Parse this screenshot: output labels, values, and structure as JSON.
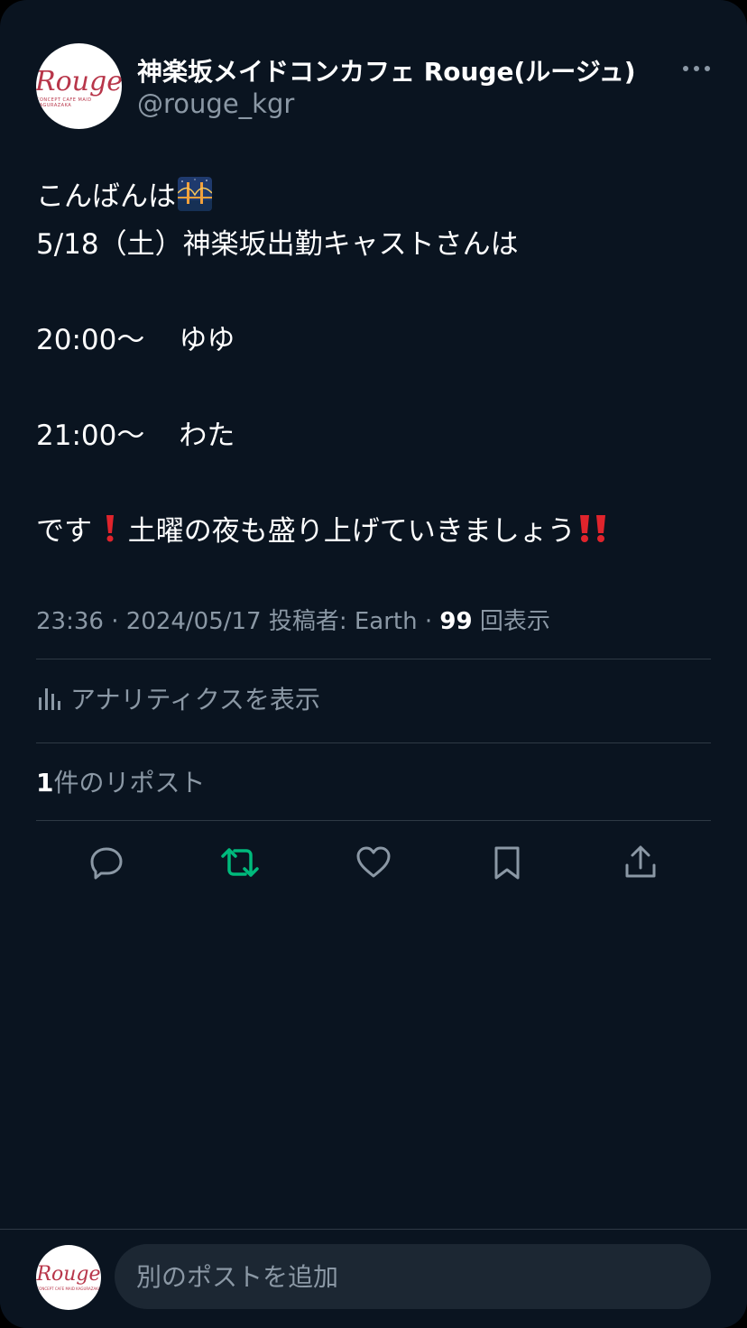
{
  "user": {
    "display_name": "神楽坂メイドコンカフェ Rouge(ルージュ)",
    "handle": "@rouge_kgr",
    "avatar_logo": "Rouge",
    "avatar_logo_sub": "CONCEPT CAFE MAID KAGURAZAKA"
  },
  "tweet": {
    "greeting": "こんばんは",
    "line2": "5/18（土）神楽坂出勤キャストさんは",
    "schedule": [
      {
        "time": "20:00〜",
        "name": "ゆゆ"
      },
      {
        "time": "21:00〜",
        "name": "わた"
      }
    ],
    "closing_start": "です",
    "closing_mid": " 土曜の夜も盛り上げていきましょう"
  },
  "meta": {
    "time": "23:36",
    "date": "2024/05/17",
    "posted_by_label": "投稿者: Earth",
    "views_count": "99",
    "views_label": "回表示",
    "separator": " · "
  },
  "analytics": {
    "label": "アナリティクスを表示",
    "icon": "bar-chart-icon"
  },
  "reposts": {
    "count": "1",
    "label": "件のリポスト"
  },
  "actions": {
    "reply_icon": "reply-icon",
    "repost_icon": "repost-icon",
    "like_icon": "heart-icon",
    "bookmark_icon": "bookmark-icon",
    "share_icon": "share-icon"
  },
  "compose": {
    "placeholder": "別のポストを追加"
  },
  "colors": {
    "background": "#0a1420",
    "text_primary": "#ffffff",
    "text_secondary": "#8b98a5",
    "repost_green": "#00ba7c",
    "divider": "#2f3a45",
    "exclamation_red": "#e0242c"
  }
}
